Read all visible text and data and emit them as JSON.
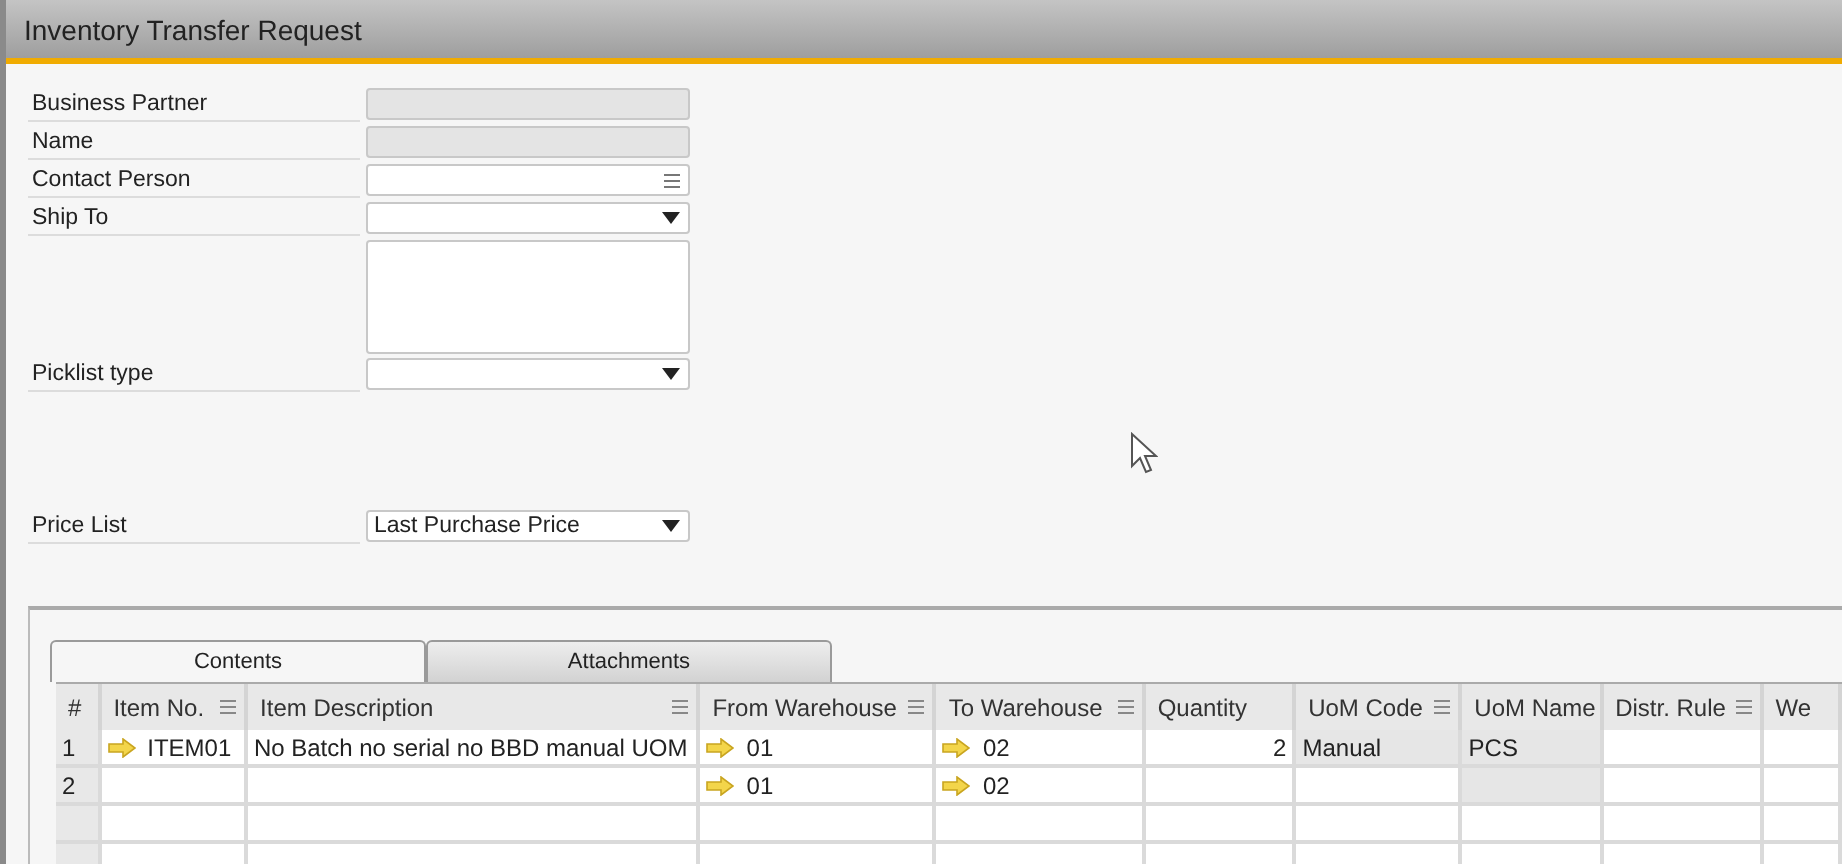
{
  "window": {
    "title": "Inventory Transfer Request"
  },
  "fields": [
    {
      "label": "Business Partner",
      "kind": "text",
      "disabled": true
    },
    {
      "label": "Name",
      "kind": "text",
      "disabled": true
    },
    {
      "label": "Contact Person",
      "kind": "list",
      "disabled": false
    },
    {
      "label": "Ship To",
      "kind": "dropdown",
      "disabled": false
    },
    {
      "kind": "textarea",
      "disabled": false
    },
    {
      "label": "Picklist type",
      "kind": "dropdown",
      "disabled": false
    }
  ],
  "price_list": {
    "label": "Price List",
    "kind": "dropdown",
    "value": "Last Purchase Price",
    "disabled": false
  },
  "tabs": [
    {
      "label": "Contents",
      "selected": true
    },
    {
      "label": "Attachments",
      "selected": false
    }
  ],
  "table": {
    "number_header": "#",
    "columns": [
      {
        "label": "Item No.",
        "menu": true
      },
      {
        "label": "Item Description",
        "menu": true
      },
      {
        "label": "From Warehouse",
        "menu": true
      },
      {
        "label": "To Warehouse",
        "menu": true
      },
      {
        "label": "Quantity",
        "menu": false
      },
      {
        "label": "UoM Code",
        "menu": true
      },
      {
        "label": "UoM Name",
        "menu": false
      },
      {
        "label": "Distr. Rule",
        "menu": true
      },
      {
        "label": "We",
        "menu": false
      }
    ],
    "rows": [
      {
        "number": "1",
        "cells": [
          {
            "text": "ITEM01",
            "link": true,
            "disabled": false
          },
          {
            "text": "No Batch no serial no BBD manual UOM",
            "link": false,
            "disabled": false
          },
          {
            "text": "01",
            "link": true,
            "disabled": false
          },
          {
            "text": "02",
            "link": true,
            "disabled": false
          },
          {
            "text": "2",
            "link": false,
            "disabled": false
          },
          {
            "text": "Manual",
            "link": false,
            "disabled": true
          },
          {
            "text": "PCS",
            "link": false,
            "disabled": true
          },
          {
            "link": false,
            "disabled": false
          },
          {
            "link": false,
            "disabled": false
          }
        ]
      },
      {
        "number": "2",
        "cells": [
          {
            "link": false,
            "disabled": false
          },
          {
            "link": false,
            "disabled": false
          },
          {
            "text": "01",
            "link": true,
            "disabled": false
          },
          {
            "text": "02",
            "link": true,
            "disabled": false
          },
          {
            "link": false,
            "disabled": false
          },
          {
            "link": false,
            "disabled": false
          },
          {
            "link": false,
            "disabled": true
          },
          {
            "link": false,
            "disabled": false
          },
          {
            "link": false,
            "disabled": false
          }
        ]
      }
    ]
  }
}
